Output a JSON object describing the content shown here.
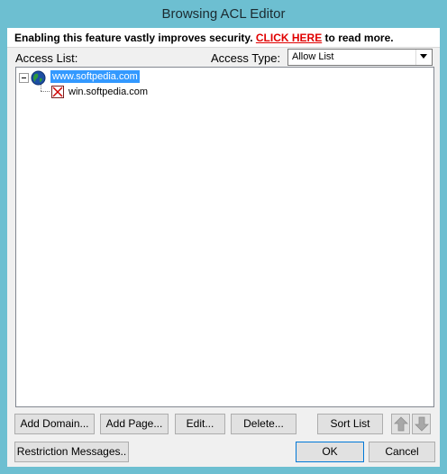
{
  "window": {
    "title": "Browsing ACL Editor"
  },
  "banner": {
    "text_before": "Enabling this feature vastly improves security. ",
    "link_text": "CLICK HERE",
    "text_after": " to read more."
  },
  "access_list": {
    "label": "Access List:",
    "items": [
      {
        "label": "www.softpedia.com",
        "icon": "globe-icon",
        "selected": true,
        "expanded": true
      },
      {
        "label": "win.softpedia.com",
        "icon": "blocked-page-icon",
        "selected": false
      }
    ]
  },
  "access_type": {
    "label": "Access Type:",
    "value": "Allow List"
  },
  "buttons": {
    "add_domain": "Add Domain...",
    "add_page": "Add Page...",
    "edit": "Edit...",
    "delete": "Delete...",
    "sort_list": "Sort List",
    "move_up_icon": "arrow-up-icon",
    "move_down_icon": "arrow-down-icon",
    "restriction_messages": "Restriction Messages..",
    "ok": "OK",
    "cancel": "Cancel"
  },
  "colors": {
    "title_bar": "#6dbfd1",
    "selection": "#3399ff",
    "link": "#e00000"
  }
}
